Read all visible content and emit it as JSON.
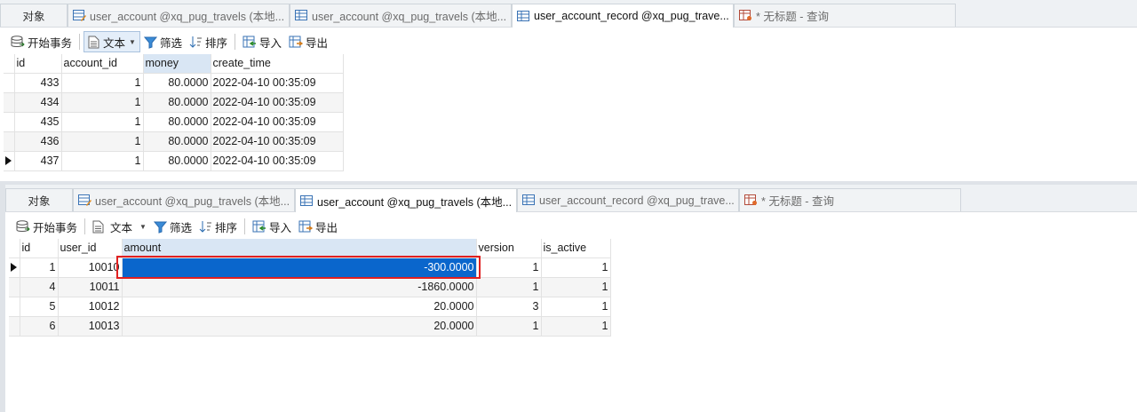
{
  "pane1": {
    "tabs": [
      {
        "label": "对象",
        "icon": "none",
        "active": false
      },
      {
        "label": "user_account @xq_pug_travels (本地...",
        "icon": "table-edit-icon",
        "active": false
      },
      {
        "label": "user_account @xq_pug_travels (本地...",
        "icon": "table-icon",
        "active": false
      },
      {
        "label": "user_account_record @xq_pug_trave...",
        "icon": "table-icon",
        "active": true
      },
      {
        "label": "* 无标题 - 查询",
        "icon": "query-icon",
        "active": false
      }
    ],
    "toolbar": {
      "begin_transaction": "开始事务",
      "text": "文本",
      "filter": "筛选",
      "sort": "排序",
      "import": "导入",
      "export": "导出"
    },
    "columns": [
      "id",
      "account_id",
      "money",
      "create_time"
    ],
    "rows": [
      [
        "433",
        "1",
        "80.0000",
        "2022-04-10 00:35:09"
      ],
      [
        "434",
        "1",
        "80.0000",
        "2022-04-10 00:35:09"
      ],
      [
        "435",
        "1",
        "80.0000",
        "2022-04-10 00:35:09"
      ],
      [
        "436",
        "1",
        "80.0000",
        "2022-04-10 00:35:09"
      ],
      [
        "437",
        "1",
        "80.0000",
        "2022-04-10 00:35:09"
      ]
    ]
  },
  "pane2": {
    "tabs": [
      {
        "label": "对象",
        "icon": "none",
        "active": false
      },
      {
        "label": "user_account @xq_pug_travels (本地...",
        "icon": "table-edit-icon",
        "active": false
      },
      {
        "label": "user_account @xq_pug_travels (本地...",
        "icon": "table-icon",
        "active": true
      },
      {
        "label": "user_account_record @xq_pug_trave...",
        "icon": "table-icon",
        "active": false
      },
      {
        "label": "* 无标题 - 查询",
        "icon": "query-icon",
        "active": false
      }
    ],
    "toolbar": {
      "begin_transaction": "开始事务",
      "text": "文本",
      "filter": "筛选",
      "sort": "排序",
      "import": "导入",
      "export": "导出"
    },
    "columns": [
      "id",
      "user_id",
      "amount",
      "version",
      "is_active"
    ],
    "rows": [
      [
        "1",
        "10010",
        "-300.0000",
        "1",
        "1"
      ],
      [
        "4",
        "10011",
        "-1860.0000",
        "1",
        "1"
      ],
      [
        "5",
        "10012",
        "20.0000",
        "3",
        "1"
      ],
      [
        "6",
        "10013",
        "20.0000",
        "1",
        "1"
      ]
    ]
  },
  "colors": {
    "selection": "#0a66cc",
    "highlight_box": "#e02020",
    "sorted_header": "#d9e6f4"
  }
}
